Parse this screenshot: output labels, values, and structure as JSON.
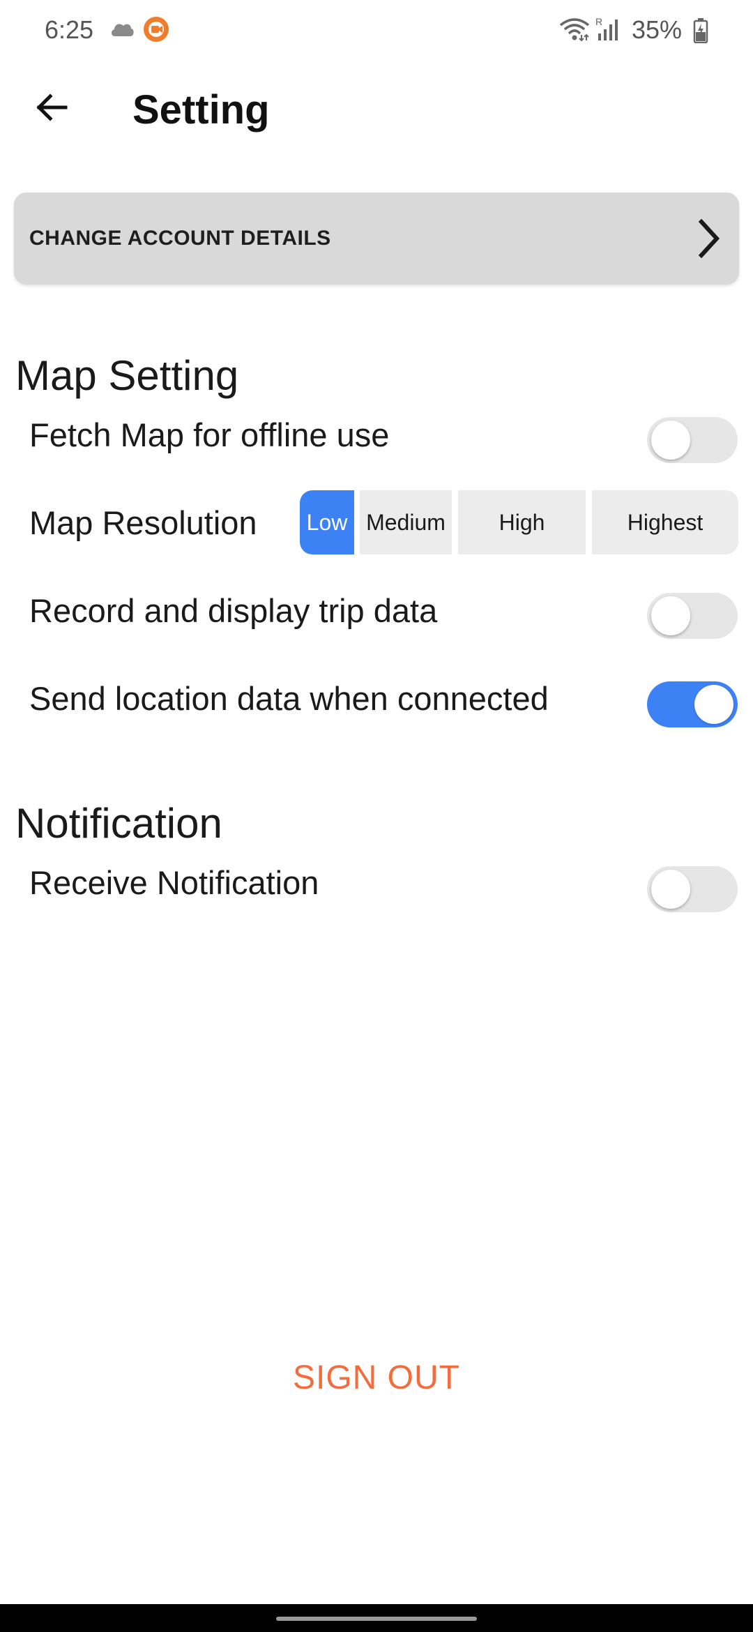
{
  "status_bar": {
    "time": "6:25",
    "battery": "35%",
    "icons": [
      "cloud-icon",
      "screen-recorder-icon",
      "wifi-icon",
      "signal-icon",
      "battery-icon"
    ]
  },
  "header": {
    "back_icon": "arrow-left-icon",
    "title": "Setting"
  },
  "account": {
    "label": "CHANGE ACCOUNT DETAILS",
    "icon": "chevron-right-icon"
  },
  "map_section": {
    "heading": "Map Setting",
    "fetch_offline": {
      "label": "Fetch Map for offline use",
      "enabled": false
    },
    "resolution": {
      "label": "Map Resolution",
      "options": [
        "Low",
        "Medium",
        "High",
        "Highest"
      ],
      "selected": "Low"
    },
    "trip_data": {
      "label": "Record and display trip data",
      "enabled": false
    },
    "send_location": {
      "label": "Send location data when connected",
      "enabled": true
    }
  },
  "notification_section": {
    "heading": "Notification",
    "receive": {
      "label": "Receive Notification",
      "enabled": false
    }
  },
  "sign_out": {
    "label": "SIGN OUT"
  },
  "colors": {
    "accent": "#3d82f5",
    "sign_out": "#f26c3e",
    "card": "#d9d9d9",
    "toggle_off": "#e6e6e6"
  }
}
